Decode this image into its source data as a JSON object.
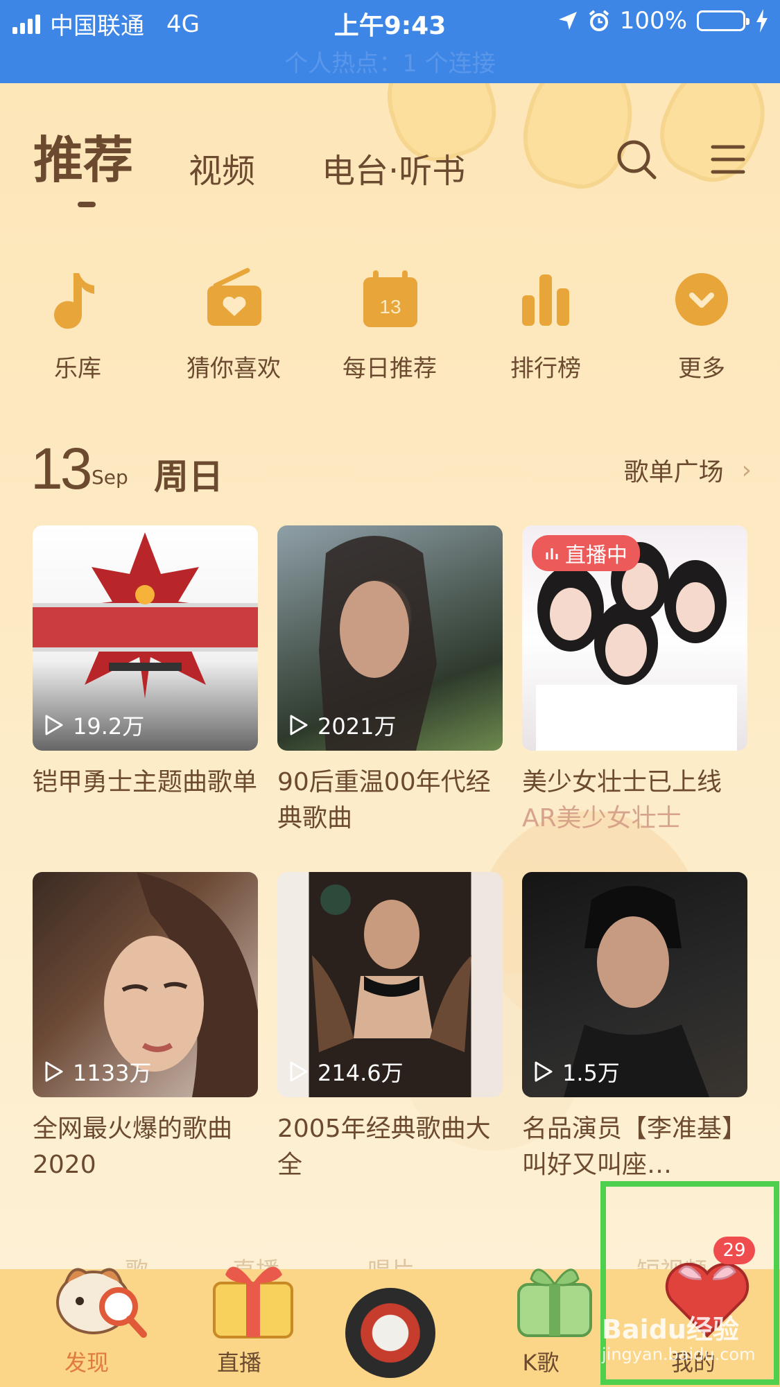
{
  "status_bar": {
    "carrier": "中国联通",
    "network": "4G",
    "time": "上午9:43",
    "battery": "100%",
    "hotspot": "个人热点：1 个连接"
  },
  "tabs": [
    {
      "label": "推荐",
      "active": true
    },
    {
      "label": "视频",
      "active": false
    },
    {
      "label": "电台·听书",
      "active": false
    }
  ],
  "quick_entries": [
    {
      "label": "乐库",
      "icon": "music-note-icon"
    },
    {
      "label": "猜你喜欢",
      "icon": "radio-heart-icon"
    },
    {
      "label": "每日推荐",
      "icon": "calendar-icon",
      "calendar_day": "13"
    },
    {
      "label": "排行榜",
      "icon": "bar-chart-icon"
    },
    {
      "label": "更多",
      "icon": "chevron-down-icon"
    }
  ],
  "date_header": {
    "day": "13",
    "month": "Sep",
    "weekday": "周日",
    "plaza_label": "歌单广场"
  },
  "playlists": [
    {
      "title": "铠甲勇士主题曲歌单",
      "plays": "19.2万"
    },
    {
      "title": "90后重温00年代经典歌曲",
      "plays": "2021万"
    },
    {
      "title": "美少女壮士已上线",
      "subtitle": "AR美少女壮士",
      "live_badge": "直播中"
    },
    {
      "title": "全网最火爆的歌曲2020",
      "plays": "1133万"
    },
    {
      "title": "2005年经典歌曲大全",
      "plays": "214.6万"
    },
    {
      "title": "名品演员【李准基】叫好又叫座…",
      "plays": "1.5万"
    }
  ],
  "bottom_ghost": [
    "歌",
    "直播",
    "唱片",
    "短视频"
  ],
  "bottom_nav": [
    {
      "label": "发现",
      "active": true
    },
    {
      "label": "直播",
      "active": false
    },
    {
      "label": "",
      "active": false
    },
    {
      "label": "K歌",
      "active": false
    },
    {
      "label": "我的",
      "active": false,
      "badge": "29"
    }
  ],
  "watermark": {
    "brand": "Baidu经验",
    "url": "jingyan.baidu.com"
  },
  "colors": {
    "status_bar": "#3e86e6",
    "accent": "#e8a63a",
    "text": "#6b4a2f",
    "nav_active": "#e07a3e",
    "live_badge": "#ec5a5a",
    "highlight": "#4ed04e"
  }
}
